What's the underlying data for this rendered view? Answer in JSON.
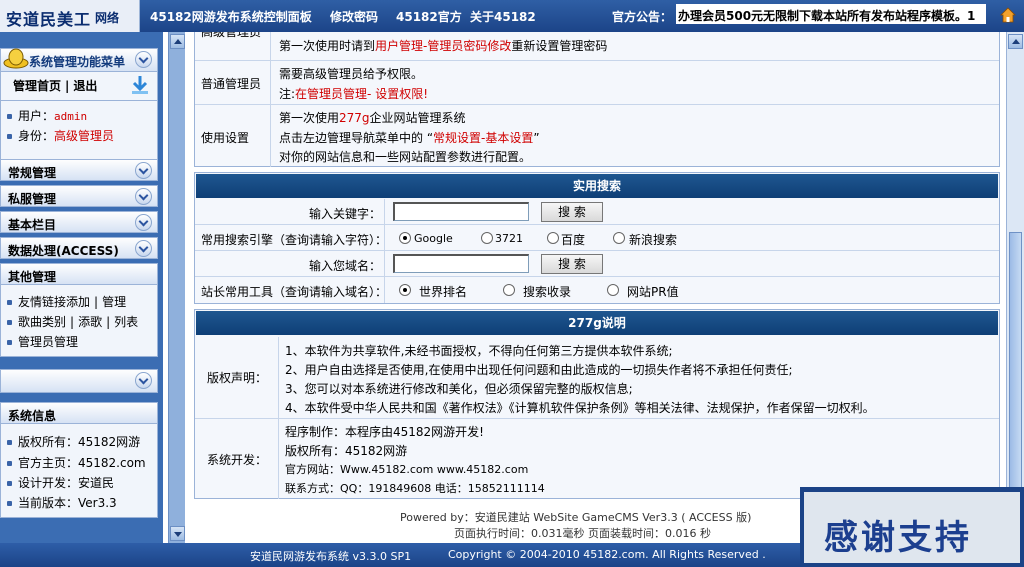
{
  "header": {
    "logo_main": "安道民美工",
    "logo_sub": "网络",
    "nav": [
      "45182网游发布系统控制面板",
      "修改密码",
      "45182官方",
      "关于45182"
    ],
    "announce_label": "官方公告：",
    "announce_text": "办理会员500元无限制下载本站所有发布站程序模板。1"
  },
  "sidebar": {
    "top_title": "系统管理功能菜单",
    "home_link": "管理首页",
    "logout_link": "退出",
    "user_label": "用户：",
    "user_value": "admin",
    "role_label": "身份：",
    "role_value": "高级管理员",
    "menus": [
      "常规管理",
      "私服管理",
      "基本栏目",
      "数据处理(ACCESS)"
    ],
    "other_title": "其他管理",
    "other_items": {
      "r1a": "友情链接添加",
      "r1b": "管理",
      "r2a": "歌曲类别",
      "r2b": "添歌",
      "r2c": "列表",
      "r3a": "管理员管理"
    },
    "sys_title": "系统信息",
    "sys_items": [
      "版权所有：45182网游",
      "官方主页：45182.com",
      "设计开发：安道民",
      "当前版本：Ver3.3"
    ]
  },
  "roles": {
    "row1_label": "高级管理员",
    "row1_text_a": "第一次使用时请到",
    "row1_text_b": "用户管理-管理员密码修改",
    "row1_text_c": "重新设置管理密码",
    "row2_label": "普通管理员",
    "row2_line1": "需要高级管理员给予权限。",
    "row2_line2_a": "注:",
    "row2_line2_b": "在管理员管理- 设置权限!",
    "row3_label": "使用设置",
    "row3_line1_a": "第一次使用",
    "row3_line1_b": "277g",
    "row3_line1_c": "企业网站管理系统",
    "row3_line2_a": "点击左边管理导航菜单中的 “",
    "row3_line2_b": "常规设置-基本设置",
    "row3_line2_c": "”",
    "row3_line3": "对你的网站信息和一些网站配置参数进行配置。"
  },
  "search": {
    "title": "实用搜索",
    "keyword_label": "输入关键字：",
    "search_btn": "搜 索",
    "engine_label": "常用搜索引擎（查询请输入字符）：",
    "engines": [
      "Google",
      "3721",
      "百度",
      "新浪搜索"
    ],
    "domain_label": "输入您域名：",
    "domain_btn": "搜 索",
    "tools_label": "站长常用工具（查询请输入域名）：",
    "tools": [
      "世界排名",
      "搜索收录",
      "网站PR值"
    ]
  },
  "about": {
    "title": "277g说明",
    "copyright_label": "版权声明：",
    "copyright_lines": [
      "1、本软件为共享软件,未经书面授权，不得向任何第三方提供本软件系统;",
      "2、用户自由选择是否使用,在使用中出现任何问题和由此造成的一切损失作者将不承担任何责任;",
      "3、您可以对本系统进行修改和美化，但必须保留完整的版权信息;",
      "4、本软件受中华人民共和国《著作权法》《计算机软件保护条例》等相关法律、法规保护，作者保留一切权利。"
    ],
    "dev_label": "系统开发：",
    "dev_lines": [
      "程序制作：本程序由45182网游开发!",
      "版权所有：45182网游",
      "官方网站：Www.45182.com      www.45182.com",
      "联系方式：QQ：191849608   电话：15852111114"
    ]
  },
  "powered": {
    "line1": "Powered by：安道民建站  WebSite GameCMS Ver3.3 ( ACCESS 版)",
    "line2": "页面执行时间：0.031毫秒   页面装载时间：0.016 秒"
  },
  "footer": {
    "left": "安道民网游发布系统 v3.3.0 SP1",
    "right": "Copyright © 2004-2010 45182.com. All Rights Reserved ."
  },
  "overlay": "感谢支持"
}
